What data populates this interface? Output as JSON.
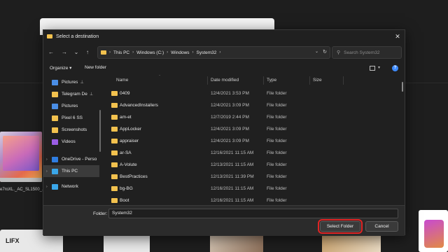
{
  "background": {
    "product_caption": "e7roXL._AC_SL1500_.",
    "lifx_label": "LIFX"
  },
  "dialog": {
    "title": "Select a destination",
    "close_glyph": "✕",
    "nav": {
      "back_glyph": "←",
      "forward_glyph": "→",
      "recent_glyph": "⌄",
      "up_glyph": "↑"
    },
    "breadcrumb": [
      "This PC",
      "Windows (C:)",
      "Windows",
      "System32"
    ],
    "breadcrumb_sep": "›",
    "search_placeholder": "Search System32",
    "toolbar": {
      "organize": "Organize ▾",
      "new_folder": "New folder",
      "help_glyph": "?"
    },
    "navpane": [
      {
        "label": "Pictures",
        "icon": "pictures-icon",
        "color": "#4a8ee6",
        "pinned": true,
        "expander": ""
      },
      {
        "label": "Telegram De",
        "icon": "folder-icon",
        "color": "#f2c14e",
        "pinned": true,
        "expander": ""
      },
      {
        "label": "Pictures",
        "icon": "pictures-icon",
        "color": "#4a8ee6",
        "pinned": false,
        "expander": ""
      },
      {
        "label": "Pixel 6 SS",
        "icon": "folder-icon",
        "color": "#f2c14e",
        "pinned": false,
        "expander": ""
      },
      {
        "label": "Screenshots",
        "icon": "folder-icon",
        "color": "#f2c14e",
        "pinned": false,
        "expander": ""
      },
      {
        "label": "Videos",
        "icon": "videos-icon",
        "color": "#9b5de5",
        "pinned": false,
        "expander": ""
      },
      {
        "label": "OneDrive - Perso",
        "icon": "onedrive-icon",
        "color": "#2f7de1",
        "pinned": false,
        "expander": "›"
      },
      {
        "label": "This PC",
        "icon": "this-pc-icon",
        "color": "#3aa6e8",
        "pinned": false,
        "expander": "›",
        "selected": true
      },
      {
        "label": "Network",
        "icon": "network-icon",
        "color": "#3aa6e8",
        "pinned": false,
        "expander": "›"
      }
    ],
    "pin_glyph": "📌",
    "columns": {
      "name": "Name",
      "date": "Date modified",
      "type": "Type",
      "size": "Size"
    },
    "files": [
      {
        "name": "0409",
        "date": "12/4/2021 3:53 PM",
        "type": "File folder"
      },
      {
        "name": "AdvancedInstallers",
        "date": "12/4/2021 3:09 PM",
        "type": "File folder"
      },
      {
        "name": "am-et",
        "date": "12/7/2019 2:44 PM",
        "type": "File folder"
      },
      {
        "name": "AppLocker",
        "date": "12/4/2021 3:09 PM",
        "type": "File folder"
      },
      {
        "name": "appraiser",
        "date": "12/4/2021 3:09 PM",
        "type": "File folder"
      },
      {
        "name": "ar-SA",
        "date": "12/16/2021 11:15 AM",
        "type": "File folder"
      },
      {
        "name": "A-Volute",
        "date": "12/13/2021 11:15 AM",
        "type": "File folder"
      },
      {
        "name": "BestPractices",
        "date": "12/13/2021 11:39 PM",
        "type": "File folder"
      },
      {
        "name": "bg-BG",
        "date": "12/16/2021 11:15 AM",
        "type": "File folder"
      },
      {
        "name": "Boot",
        "date": "12/16/2021 11:15 AM",
        "type": "File folder"
      }
    ],
    "footer": {
      "folder_label": "Folder:",
      "folder_value": "System32",
      "select_button": "Select Folder",
      "cancel_button": "Cancel"
    }
  },
  "colors": {
    "folder": "#f2c14e",
    "highlight": "#e02424",
    "accent": "#3f8cff"
  }
}
